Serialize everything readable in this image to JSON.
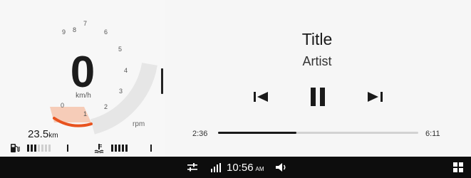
{
  "gauge": {
    "speed": "0",
    "speed_unit": "km/h",
    "rpm_unit": "rpm",
    "rpm_ticks": [
      "0",
      "1",
      "2",
      "3",
      "4",
      "5",
      "6",
      "7",
      "8",
      "9"
    ],
    "redline_color": "#e8531f",
    "redline_zone_color": "#f5c7b0"
  },
  "odometer": {
    "value": "23.5",
    "unit": "km"
  },
  "fuel": {
    "level_bars": 3,
    "total_bars": 7
  },
  "temperature": {
    "level_bars": 5,
    "total_bars": 5
  },
  "media": {
    "title": "Title",
    "artist": "Artist",
    "elapsed": "2:36",
    "duration": "6:11",
    "progress": 0.39
  },
  "status_bar": {
    "time": "10:56",
    "ampm": "AM",
    "icons": [
      "equalizer-icon",
      "signal-icon",
      "volume-icon",
      "apps-grid-icon"
    ]
  }
}
